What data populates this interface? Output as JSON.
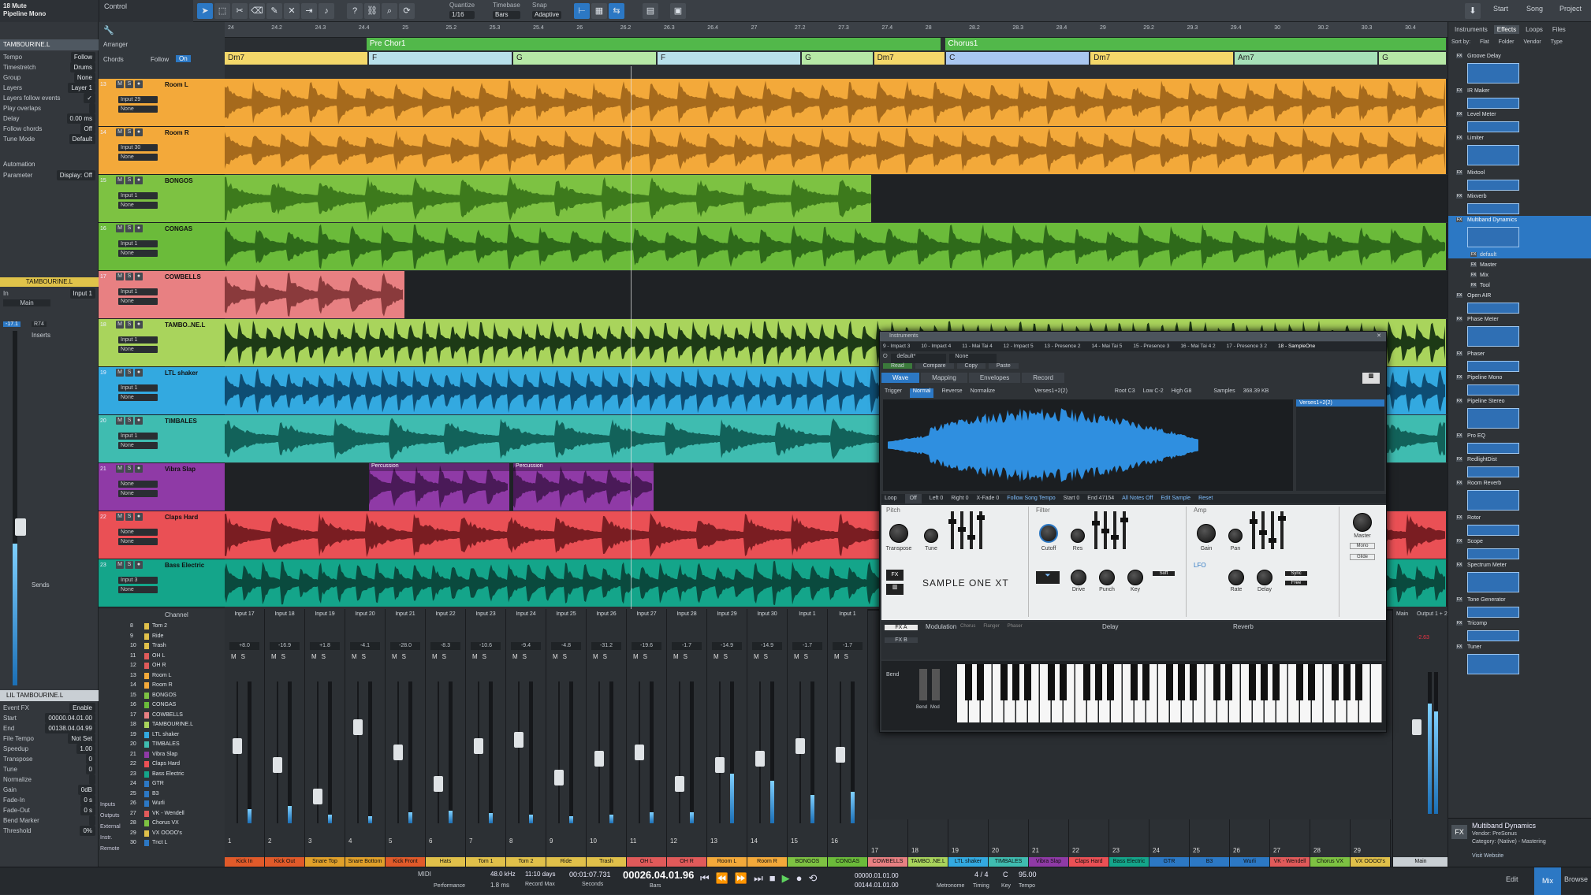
{
  "toolbar": {
    "track_no": "18",
    "mute_label": "Mute",
    "track_name": "Pipeline Mono",
    "control_label": "Control",
    "quantize_label": "Quantize",
    "quantize_value": "1/16",
    "timebase_label": "Timebase",
    "timebase_value": "Bars",
    "snap_label": "Snap",
    "snap_value": "Adaptive",
    "right_tabs": [
      "Start",
      "Song",
      "Project"
    ]
  },
  "inspector": {
    "track_name": "TAMBOURINE.L",
    "rows": [
      {
        "k": "Tempo",
        "v": "Follow"
      },
      {
        "k": "Timestretch",
        "v": "Drums"
      },
      {
        "k": "Group",
        "v": "None"
      },
      {
        "k": "Layers",
        "v": "Layer 1"
      },
      {
        "k": "Layers follow events",
        "v": "✓"
      },
      {
        "k": "Play overlaps",
        "v": ""
      },
      {
        "k": "Delay",
        "v": "0.00 ms"
      },
      {
        "k": "Follow chords",
        "v": "Off"
      },
      {
        "k": "Tune Mode",
        "v": "Default"
      }
    ],
    "automation_label": "Automation",
    "parameter_label": "Parameter",
    "parameter_value": "Display: Off",
    "channel_name": "TAMBOURINE.L",
    "input_label": "In",
    "input_value": "Input 1",
    "main_label": "Main",
    "level_value": "-17.1",
    "pan_value": "R74",
    "inserts_label": "Inserts",
    "sends_label": "Sends",
    "event_name": "LIL TAMBOURINE.L",
    "event_rows": [
      {
        "k": "Event FX",
        "v": "Enable"
      },
      {
        "k": "Start",
        "v": "00000.04.01.00"
      },
      {
        "k": "End",
        "v": "00138.04.04.99"
      },
      {
        "k": "File Tempo",
        "v": "Not Set"
      },
      {
        "k": "Speedup",
        "v": "1.00"
      },
      {
        "k": "Transpose",
        "v": "0"
      },
      {
        "k": "Tune",
        "v": "0"
      },
      {
        "k": "Normalize",
        "v": ""
      },
      {
        "k": "Gain",
        "v": "0dB"
      },
      {
        "k": "Fade-In",
        "v": "0 s"
      },
      {
        "k": "Fade-Out",
        "v": "0 s"
      },
      {
        "k": "Bend Marker",
        "v": ""
      },
      {
        "k": "Threshold",
        "v": "0%"
      }
    ]
  },
  "arranger": {
    "label": "Arranger",
    "chords_label": "Chords",
    "follow_label": "Follow",
    "follow_value": "On",
    "ruler": [
      "24",
      "24.2",
      "24.3",
      "24.4",
      "25",
      "25.2",
      "25.3",
      "25.4",
      "26",
      "26.2",
      "26.3",
      "26.4",
      "27",
      "27.2",
      "27.3",
      "27.4",
      "28",
      "28.2",
      "28.3",
      "28.4",
      "29",
      "29.2",
      "29.3",
      "29.4",
      "30",
      "30.2",
      "30.3",
      "30.4"
    ],
    "sections": [
      {
        "name": "Pre Chor1",
        "pos": 0.116,
        "len": 0.471
      },
      {
        "name": "Chorus1",
        "pos": 0.589,
        "len": 0.411
      }
    ],
    "chords": [
      {
        "name": "Dm7",
        "pos": 0.0,
        "len": 0.118
      },
      {
        "name": "F",
        "pos": 0.118,
        "len": 0.118
      },
      {
        "name": "G",
        "pos": 0.236,
        "len": 0.118
      },
      {
        "name": "F",
        "pos": 0.354,
        "len": 0.118
      },
      {
        "name": "G",
        "pos": 0.472,
        "len": 0.059
      },
      {
        "name": "Dm7",
        "pos": 0.531,
        "len": 0.059
      },
      {
        "name": "C",
        "pos": 0.59,
        "len": 0.118
      },
      {
        "name": "Dm7",
        "pos": 0.708,
        "len": 0.118
      },
      {
        "name": "Am7",
        "pos": 0.826,
        "len": 0.118
      },
      {
        "name": "G",
        "pos": 0.944,
        "len": 0.056
      }
    ]
  },
  "tracks": [
    {
      "num": "13",
      "name": "Room L",
      "input": "Input 29",
      "out": "None",
      "color": "#f3a93a",
      "wave": "#a66a1c",
      "clips": [
        [
          0,
          1
        ]
      ]
    },
    {
      "num": "14",
      "name": "Room R",
      "input": "Input 30",
      "out": "None",
      "color": "#f3a93a",
      "wave": "#a66a1c",
      "clips": [
        [
          0,
          1
        ]
      ]
    },
    {
      "num": "15",
      "name": "BONGOS",
      "input": "Input 1",
      "out": "None",
      "color": "#7dc242",
      "wave": "#3d7a1c",
      "clips": [
        [
          0,
          0.53
        ]
      ]
    },
    {
      "num": "16",
      "name": "CONGAS",
      "input": "Input 1",
      "out": "None",
      "color": "#6bbb3a",
      "wave": "#2e6a1a",
      "clips": [
        [
          0,
          1
        ]
      ]
    },
    {
      "num": "17",
      "name": "COWBELLS",
      "input": "Input 1",
      "out": "None",
      "color": "#e88082",
      "wave": "#8a3a3c",
      "clips": [
        [
          0,
          0.148
        ]
      ]
    },
    {
      "num": "18",
      "name": "TAMBO..NE.L",
      "input": "Input 1",
      "out": "None",
      "color": "#a9d45c",
      "wave": "#1d3a16",
      "clips": [
        [
          0,
          1
        ]
      ]
    },
    {
      "num": "19",
      "name": "LTL shaker",
      "input": "Input 1",
      "out": "None",
      "color": "#33a9e0",
      "wave": "#0e4d73",
      "clips": [
        [
          0,
          1
        ]
      ]
    },
    {
      "num": "20",
      "name": "TIMBALES",
      "input": "Input 1",
      "out": "None",
      "color": "#3fbcb0",
      "wave": "#12625a",
      "clips": [
        [
          0,
          1
        ]
      ]
    },
    {
      "num": "21",
      "name": "Vibra Slap",
      "input": "None",
      "out": "None",
      "color": "#8f3aa6",
      "wave": "#4a1a58",
      "clips": [
        [
          0.118,
          0.116
        ],
        [
          0.236,
          0.116
        ]
      ],
      "clip_label": "Percussion"
    },
    {
      "num": "22",
      "name": "Claps Hard",
      "input": "None",
      "out": "None",
      "color": "#ea5055",
      "wave": "#7a1d22",
      "clips": [
        [
          0,
          1
        ]
      ]
    },
    {
      "num": "23",
      "name": "Bass Electric",
      "input": "Input 3",
      "out": "None",
      "color": "#14a58a",
      "wave": "#0a4a3e",
      "clips": [
        [
          0,
          1
        ]
      ]
    }
  ],
  "mixer": {
    "channel_label": "Channel",
    "channel_list": [
      {
        "n": "8",
        "name": "Tom 2",
        "c": "#e0c04a"
      },
      {
        "n": "9",
        "name": "Ride",
        "c": "#e0c04a"
      },
      {
        "n": "10",
        "name": "Trash",
        "c": "#e0c04a"
      },
      {
        "n": "11",
        "name": "OH L",
        "c": "#e05a5a"
      },
      {
        "n": "12",
        "name": "OH R",
        "c": "#e05a5a"
      },
      {
        "n": "13",
        "name": "Room L",
        "c": "#f3a93a"
      },
      {
        "n": "14",
        "name": "Room R",
        "c": "#f3a93a"
      },
      {
        "n": "15",
        "name": "BONGOS",
        "c": "#7dc242"
      },
      {
        "n": "16",
        "name": "CONGAS",
        "c": "#6bbb3a"
      },
      {
        "n": "17",
        "name": "COWBELLS",
        "c": "#e88082"
      },
      {
        "n": "18",
        "name": "TAMBOURINE.L",
        "c": "#a9d45c"
      },
      {
        "n": "19",
        "name": "LTL shaker",
        "c": "#33a9e0"
      },
      {
        "n": "20",
        "name": "TIMBALES",
        "c": "#3fbcb0"
      },
      {
        "n": "21",
        "name": "Vibra Slap",
        "c": "#8f3aa6"
      },
      {
        "n": "22",
        "name": "Claps Hard",
        "c": "#ea5055"
      },
      {
        "n": "23",
        "name": "Bass Electric",
        "c": "#14a58a"
      },
      {
        "n": "24",
        "name": "GTR",
        "c": "#2c78c4"
      },
      {
        "n": "25",
        "name": "B3",
        "c": "#2c78c4"
      },
      {
        "n": "26",
        "name": "Wurli",
        "c": "#2c78c4"
      },
      {
        "n": "27",
        "name": "VK - Wendell",
        "c": "#e05a5a"
      },
      {
        "n": "28",
        "name": "Chorus VX",
        "c": "#7dc242"
      },
      {
        "n": "29",
        "name": "VX OOOO's",
        "c": "#e0c04a"
      },
      {
        "n": "30",
        "name": "Tnct L",
        "c": "#2c78c4"
      }
    ],
    "side_buttons": [
      "Inputs",
      "Outputs",
      "External",
      "Instr.",
      "Remote"
    ],
    "strips": [
      {
        "in": "Input 17",
        "pan": "+8.0",
        "no": "1",
        "name": "Kick In",
        "c": "#e05a2a",
        "fader": 0.55,
        "level": 0.1
      },
      {
        "in": "Input 18",
        "pan": "-16.9",
        "no": "2",
        "name": "Kick Out",
        "c": "#e05a2a",
        "fader": 0.4,
        "level": 0.12
      },
      {
        "in": "Input 19",
        "pan": "+1.8",
        "no": "3",
        "name": "Snare Top",
        "c": "#e0a02a",
        "fader": 0.15,
        "level": 0.06
      },
      {
        "in": "Input 20",
        "pan": "-4.1",
        "no": "4",
        "name": "Snare Bottom",
        "c": "#e0a02a",
        "fader": 0.7,
        "level": 0.05
      },
      {
        "in": "Input 21",
        "pan": "-28.0",
        "no": "5",
        "name": "Kick Front",
        "c": "#e05a2a",
        "fader": 0.5,
        "level": 0.08
      },
      {
        "in": "Input 22",
        "pan": "-8.3",
        "no": "6",
        "name": "Hats",
        "c": "#e0c04a",
        "fader": 0.25,
        "level": 0.09
      },
      {
        "in": "Input 23",
        "pan": "-10.6",
        "no": "7",
        "name": "Tom 1",
        "c": "#e0c04a",
        "fader": 0.55,
        "level": 0.07
      },
      {
        "in": "Input 24",
        "pan": "-9.4",
        "no": "8",
        "name": "Tom 2",
        "c": "#e0c04a",
        "fader": 0.6,
        "level": 0.06
      },
      {
        "in": "Input 25",
        "pan": "-4.8",
        "no": "9",
        "name": "Ride",
        "c": "#e0c04a",
        "fader": 0.3,
        "level": 0.05
      },
      {
        "in": "Input 26",
        "pan": "-31.2",
        "no": "10",
        "name": "Trash",
        "c": "#e0c04a",
        "fader": 0.45,
        "level": 0.06
      },
      {
        "in": "Input 27",
        "pan": "-19.6",
        "no": "11",
        "name": "OH L",
        "c": "#e05a5a",
        "fader": 0.5,
        "level": 0.08
      },
      {
        "in": "Input 28",
        "pan": "-1.7",
        "no": "12",
        "name": "OH R",
        "c": "#e05a5a",
        "fader": 0.25,
        "level": 0.08
      },
      {
        "in": "Input 29",
        "pan": "-14.9",
        "no": "13",
        "name": "Room L",
        "c": "#f3a93a",
        "fader": 0.4,
        "level": 0.35
      },
      {
        "in": "Input 30",
        "pan": "-14.9",
        "no": "14",
        "name": "Room R",
        "c": "#f3a93a",
        "fader": 0.45,
        "level": 0.3
      },
      {
        "in": "Input 1",
        "pan": "-1.7",
        "no": "15",
        "name": "BONGOS",
        "c": "#7dc242",
        "fader": 0.55,
        "level": 0.2
      },
      {
        "in": "Input 1",
        "pan": "-1.7",
        "no": "16",
        "name": "CONGAS",
        "c": "#6bbb3a",
        "fader": 0.48,
        "level": 0.22
      }
    ],
    "right_strips": [
      {
        "no": "17",
        "name": "COWBELLS",
        "c": "#e88082"
      },
      {
        "no": "18",
        "name": "TAMBO..NE.L",
        "c": "#a9d45c"
      },
      {
        "no": "19",
        "name": "LTL shaker",
        "c": "#33a9e0"
      },
      {
        "no": "20",
        "name": "TIMBALES",
        "c": "#3fbcb0"
      },
      {
        "no": "21",
        "name": "Vibra Slap",
        "c": "#8f3aa6"
      },
      {
        "no": "22",
        "name": "Claps Hard",
        "c": "#ea5055"
      },
      {
        "no": "23",
        "name": "Bass Electric",
        "c": "#14a58a"
      },
      {
        "no": "24",
        "name": "GTR",
        "c": "#2c78c4"
      },
      {
        "no": "25",
        "name": "B3",
        "c": "#2c78c4"
      },
      {
        "no": "26",
        "name": "Wurli",
        "c": "#2c78c4"
      },
      {
        "no": "27",
        "name": "VK - Wendell",
        "c": "#e05a5a"
      },
      {
        "no": "28",
        "name": "Chorus VX",
        "c": "#7dc242"
      },
      {
        "no": "29",
        "name": "VX OOOO's",
        "c": "#e0c04a"
      }
    ],
    "main_label": "Main",
    "output_label": "Output 1 + 2",
    "main_value": "-2.63"
  },
  "instrument": {
    "window_title": "Instruments",
    "tabs": [
      "9 - Impact 3",
      "10 - Impact 4",
      "11 - Mai Tai 4",
      "12 - Impact 5",
      "13 - Presence 2",
      "14 - Mai Tai 5",
      "15 - Presence 3",
      "16 - Mai Tai 4 2",
      "17 - Presence 3 2",
      "18 - SampleOne"
    ],
    "preset": "default*",
    "route": "None",
    "buttons": [
      "Read",
      "Compare",
      "Copy",
      "Paste"
    ],
    "view_tabs": [
      "Wave",
      "Mapping",
      "Envelopes",
      "Record"
    ],
    "trigger_label": "Trigger",
    "trigger_value": "Normal",
    "reverse": "Reverse",
    "normalize": "Normalize",
    "sample_name": "Verses1+2(2)",
    "root": "Root C3",
    "low": "Low C-2",
    "high": "High G8",
    "samples_label": "Samples",
    "samples_size": "368.39 KB",
    "sample_list": [
      "Verses1+2(2)"
    ],
    "loop_label": "Loop",
    "loop_value": "Off",
    "left_label": "Left 0",
    "right_label": "Right 0",
    "xfade": "X-Fade 0",
    "follow": "Follow Song Tempo",
    "start": "Start 0",
    "end": "End 47154",
    "all_notes": "All Notes Off",
    "edit_sample": "Edit Sample",
    "reset": "Reset",
    "pitch_title": "Pitch",
    "filter_title": "Filter",
    "amp_title": "Amp",
    "lfo_title": "LFO",
    "pitch_knobs": [
      "Transpose",
      "Tune"
    ],
    "filter_knobs": [
      "Cutoff",
      "Res"
    ],
    "amp_knobs": [
      "Gain",
      "Pan"
    ],
    "lower_knobs": [
      "Drive",
      "Punch",
      "Key",
      "Rate",
      "Delay"
    ],
    "master_label": "Master",
    "mono": "Mono",
    "glide": "Glide",
    "logo": "SAMPLE ONE XT",
    "fx_buttons": [
      "FX A",
      "FX B"
    ],
    "modulation": "Modulation",
    "chorus": "Chorus",
    "flanger": "Flanger",
    "phaser": "Phaser",
    "delay_title": "Delay",
    "reverb_title": "Reverb",
    "bend": "Bend",
    "mod": "Mod",
    "sync": "Sync",
    "free": "Free",
    "soft": "Soft"
  },
  "browser": {
    "tabs": [
      "Instruments",
      "Effects",
      "Loops",
      "Files"
    ],
    "sort_label": "Sort by:",
    "sort_options": [
      "Flat",
      "Folder",
      "Vendor",
      "Type"
    ],
    "items": [
      "Groove Delay",
      "IR Maker",
      "Level Meter",
      "Limiter",
      "Mixtool",
      "Mixverb",
      "Multiband Dynamics",
      "default",
      "Master",
      "Mix",
      "Tool",
      "Open AIR",
      "Phase Meter",
      "Phaser",
      "Pipeline Mono",
      "Pipeline Stereo",
      "Pro EQ",
      "RedlightDist",
      "Room Reverb",
      "Rotor",
      "Scope",
      "Spectrum Meter",
      "Tone Generator",
      "Tricomp",
      "Tuner"
    ],
    "selected": "Multiband Dynamics",
    "footer_name": "Multiband Dynamics",
    "footer_vendor": "Vendor: PreSonus",
    "footer_category": "Category: (Native) - Mastering",
    "footer_link": "Visit Website"
  },
  "transport": {
    "midi": "MIDI",
    "performance": "Performance",
    "sample_rate": "48.0 kHz",
    "latency": "1.8 ms",
    "record_days": "11:10 days",
    "record_max": "Record Max",
    "seconds": "00:01:07.731",
    "seconds_label": "Seconds",
    "bars": "00026.04.01.96",
    "bars_label": "Bars",
    "loop_start": "00000.01.01.00",
    "loop_end": "00144.01.01.00",
    "metronome": "Metronome",
    "timing": "4 / 4",
    "timing_label": "Timing",
    "key": "C",
    "key_label": "Key",
    "tempo": "95.00",
    "tempo_label": "Tempo",
    "right_tabs": [
      "Edit",
      "Mix",
      "Browse"
    ]
  },
  "colors": {
    "accent": "#2c78c4",
    "bg": "#2b2f33"
  }
}
